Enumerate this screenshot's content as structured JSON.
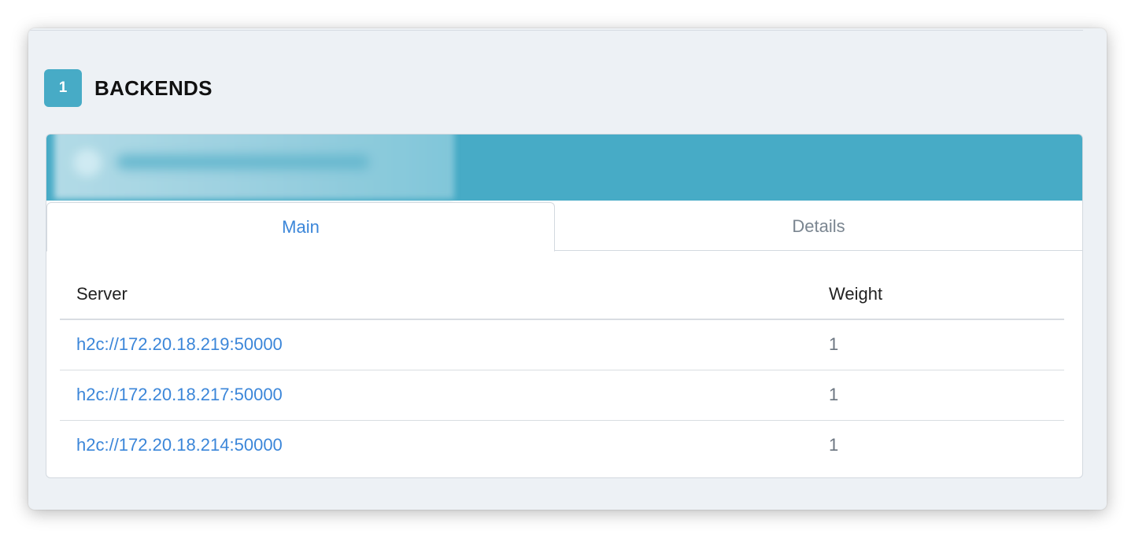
{
  "section": {
    "number": "1",
    "title": "BACKENDS"
  },
  "tabs": [
    {
      "label": "Main",
      "active": true
    },
    {
      "label": "Details",
      "active": false
    }
  ],
  "table": {
    "headers": {
      "server": "Server",
      "weight": "Weight"
    },
    "rows": [
      {
        "server": "h2c://172.20.18.219:50000",
        "weight": "1"
      },
      {
        "server": "h2c://172.20.18.217:50000",
        "weight": "1"
      },
      {
        "server": "h2c://172.20.18.214:50000",
        "weight": "1"
      }
    ]
  },
  "colors": {
    "accent": "#47abc6",
    "link": "#3b86d9",
    "background": "#edf1f5"
  }
}
